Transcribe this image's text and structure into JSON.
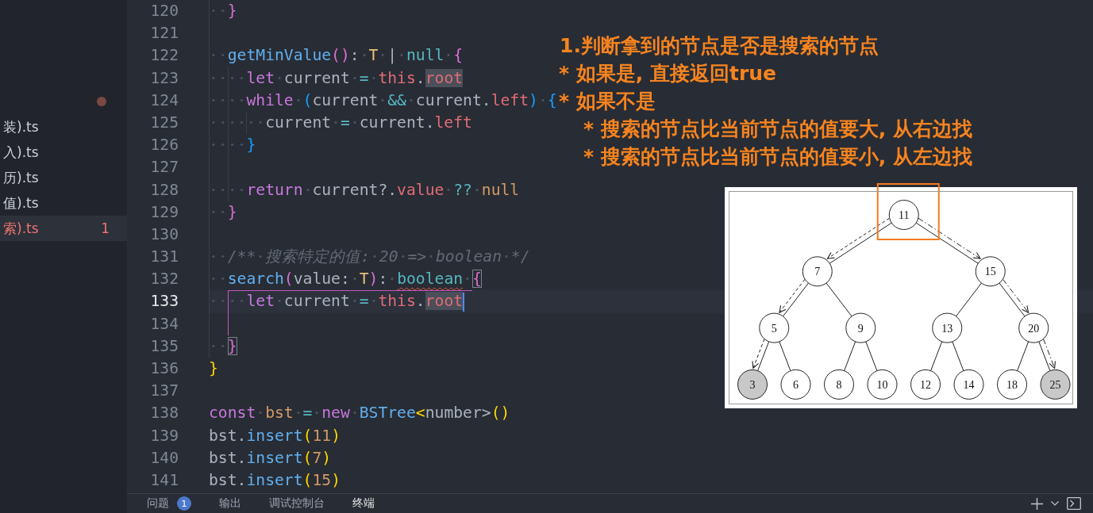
{
  "sidebar": {
    "modified": true,
    "items": [
      {
        "label": "装).ts",
        "selected": false,
        "error": false
      },
      {
        "label": "入).ts",
        "selected": false,
        "error": false
      },
      {
        "label": "历).ts",
        "selected": false,
        "error": false
      },
      {
        "label": "值).ts",
        "selected": false,
        "error": false
      },
      {
        "label": "索).ts",
        "selected": true,
        "error": true,
        "problems": "1"
      }
    ]
  },
  "editor": {
    "lines": [
      {
        "number": "120",
        "active": false,
        "tokens": [
          {
            "t": "  }",
            "kind": "bracket2"
          }
        ]
      },
      {
        "number": "121",
        "active": false
      },
      {
        "number": "122",
        "active": false,
        "tokens": [
          {
            "t": "  getMinValue",
            "kind": "function"
          },
          {
            "t": "()",
            "kind": "bracket2"
          },
          {
            "t": ": ",
            "kind": "plain"
          },
          {
            "t": "T",
            "kind": "type"
          },
          {
            "t": " | ",
            "kind": "plain"
          },
          {
            "t": "null",
            "kind": "builtin"
          },
          {
            "t": " {",
            "kind": "bracket2"
          }
        ]
      },
      {
        "number": "123",
        "active": false,
        "tokens": [
          {
            "t": "    let",
            "kind": "keyword"
          },
          {
            "t": " current ",
            "kind": "plain"
          },
          {
            "t": "=",
            "kind": "operator"
          },
          {
            "t": " this",
            "kind": "self"
          },
          {
            "t": ".",
            "kind": "plain"
          },
          {
            "t": "root",
            "kind": "occurrence"
          }
        ]
      },
      {
        "number": "124",
        "active": false,
        "tokens": [
          {
            "t": "    while",
            "kind": "keyword"
          },
          {
            "t": " (",
            "kind": "bracket3"
          },
          {
            "t": "current ",
            "kind": "plain"
          },
          {
            "t": "&&",
            "kind": "operator"
          },
          {
            "t": " current.",
            "kind": "plain"
          },
          {
            "t": "left",
            "kind": "property"
          },
          {
            "t": ") {",
            "kind": "bracket3"
          }
        ]
      },
      {
        "number": "125",
        "active": false,
        "tokens": [
          {
            "t": "      current ",
            "kind": "plain"
          },
          {
            "t": "=",
            "kind": "operator"
          },
          {
            "t": " current.",
            "kind": "plain"
          },
          {
            "t": "left",
            "kind": "property"
          }
        ]
      },
      {
        "number": "126",
        "active": false,
        "tokens": [
          {
            "t": "    }",
            "kind": "bracket3"
          }
        ]
      },
      {
        "number": "127",
        "active": false
      },
      {
        "number": "128",
        "active": false,
        "tokens": [
          {
            "t": "    return",
            "kind": "keyword"
          },
          {
            "t": " current?.",
            "kind": "plain"
          },
          {
            "t": "value",
            "kind": "property"
          },
          {
            "t": " ??",
            "kind": "operator"
          },
          {
            "t": " null",
            "kind": "literal"
          }
        ]
      },
      {
        "number": "129",
        "active": false,
        "tokens": [
          {
            "t": "  }",
            "kind": "bracket2"
          }
        ]
      },
      {
        "number": "130",
        "active": false
      },
      {
        "number": "131",
        "active": false,
        "tokens": [
          {
            "t": "  /** 搜索特定的值: 20 => boolean */",
            "kind": "comment"
          }
        ]
      },
      {
        "number": "132",
        "active": false,
        "tokens": [
          {
            "t": "  search",
            "kind": "function"
          },
          {
            "t": "(",
            "kind": "bracket2"
          },
          {
            "t": "value: ",
            "kind": "plain"
          },
          {
            "t": "T",
            "kind": "type"
          },
          {
            "t": ")",
            "kind": "bracket2"
          },
          {
            "t": ": ",
            "kind": "plain"
          },
          {
            "t": "boolean",
            "kind": "error"
          },
          {
            "t": " {",
            "kind": "match"
          }
        ]
      },
      {
        "number": "133",
        "active": true,
        "tokens": [
          {
            "t": "    let",
            "kind": "keyword"
          },
          {
            "t": " current ",
            "kind": "plain"
          },
          {
            "t": "=",
            "kind": "operator"
          },
          {
            "t": " this",
            "kind": "self"
          },
          {
            "t": ".",
            "kind": "plain"
          },
          {
            "t": "root",
            "kind": "occurrence"
          }
        ]
      },
      {
        "number": "134",
        "active": false
      },
      {
        "number": "135",
        "active": false,
        "tokens": [
          {
            "t": "  }",
            "kind": "match"
          }
        ]
      },
      {
        "number": "136",
        "active": false,
        "tokens": [
          {
            "t": "}",
            "kind": "bracket1"
          }
        ]
      },
      {
        "number": "137",
        "active": false
      },
      {
        "number": "138",
        "active": false,
        "tokens": [
          {
            "t": "const",
            "kind": "keyword"
          },
          {
            "t": " bst",
            "kind": "constant"
          },
          {
            "t": " =",
            "kind": "operator"
          },
          {
            "t": " new",
            "kind": "keyword"
          },
          {
            "t": " BSTree",
            "kind": "function"
          },
          {
            "t": "<",
            "kind": "bracket1"
          },
          {
            "t": "number>",
            "kind": "plain"
          },
          {
            "t": "()",
            "kind": "bracket1"
          }
        ]
      },
      {
        "number": "139",
        "active": false,
        "tokens": [
          {
            "t": "bst.",
            "kind": "plain"
          },
          {
            "t": "insert",
            "kind": "function"
          },
          {
            "t": "(",
            "kind": "bracket1"
          },
          {
            "t": "11",
            "kind": "literal"
          },
          {
            "t": ")",
            "kind": "bracket1"
          }
        ]
      },
      {
        "number": "140",
        "active": false,
        "tokens": [
          {
            "t": "bst.",
            "kind": "plain"
          },
          {
            "t": "insert",
            "kind": "function"
          },
          {
            "t": "(",
            "kind": "bracket1"
          },
          {
            "t": "7",
            "kind": "literal"
          },
          {
            "t": ")",
            "kind": "bracket1"
          }
        ]
      },
      {
        "number": "141",
        "active": false,
        "tokens": [
          {
            "t": "bst.",
            "kind": "plain"
          },
          {
            "t": "insert",
            "kind": "function"
          },
          {
            "t": "(",
            "kind": "bracket1"
          },
          {
            "t": "15",
            "kind": "literal"
          },
          {
            "t": ")",
            "kind": "bracket1"
          }
        ]
      }
    ]
  },
  "annotation": {
    "heading": "1.判断拿到的节点是否是搜索的节点",
    "points": [
      {
        "text": "* 如果是, 直接返回true"
      },
      {
        "text": "* 如果不是",
        "children": [
          {
            "text": "* 搜索的节点比当前节点的值要大, 从右边找"
          },
          {
            "text": "* 搜索的节点比当前节点的值要小, 从左边找"
          }
        ]
      }
    ]
  },
  "diagram": {
    "root": {
      "label": "11",
      "shaded": false,
      "highlighted": true,
      "children": [
        {
          "label": "7",
          "shaded": false,
          "kind": "dashed",
          "children": [
            {
              "label": "5",
              "shaded": false,
              "kind": "dashed",
              "children": [
                {
                  "label": "3",
                  "shaded": true,
                  "kind": "dashed"
                },
                {
                  "label": "6",
                  "shaded": false,
                  "kind": "plain"
                }
              ]
            },
            {
              "label": "9",
              "shaded": false,
              "kind": "plain",
              "children": [
                {
                  "label": "8",
                  "shaded": false,
                  "kind": "plain"
                },
                {
                  "label": "10",
                  "shaded": false,
                  "kind": "plain"
                }
              ]
            }
          ]
        },
        {
          "label": "15",
          "shaded": false,
          "kind": "dashdot",
          "children": [
            {
              "label": "13",
              "shaded": false,
              "kind": "plain",
              "children": [
                {
                  "label": "12",
                  "shaded": false,
                  "kind": "plain"
                },
                {
                  "label": "14",
                  "shaded": false,
                  "kind": "plain"
                }
              ]
            },
            {
              "label": "20",
              "shaded": false,
              "kind": "dashdot",
              "children": [
                {
                  "label": "18",
                  "shaded": false,
                  "kind": "plain"
                },
                {
                  "label": "25",
                  "shaded": true,
                  "kind": "dashdot"
                }
              ]
            }
          ]
        }
      ]
    }
  },
  "panel": {
    "tabs": [
      {
        "label": "问题",
        "badge": "1",
        "selected": false
      },
      {
        "label": "输出",
        "selected": false
      },
      {
        "label": "调试控制台",
        "selected": false
      },
      {
        "label": "终端",
        "selected": true
      }
    ]
  }
}
